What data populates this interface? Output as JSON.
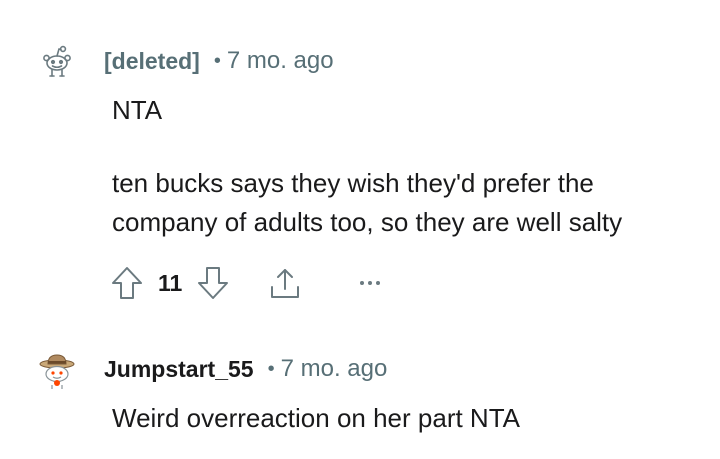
{
  "comments": [
    {
      "author": "[deleted]",
      "separator": "•",
      "time": "7 mo. ago",
      "paragraphs": [
        "NTA",
        "ten bucks says they wish they'd prefer the company of adults too, so they are well salty"
      ],
      "score": "11",
      "avatar_icon": "snoo-outline-icon",
      "actions": {
        "upvote_icon": "upvote-arrow-icon",
        "downvote_icon": "downvote-arrow-icon",
        "share_icon": "share-icon",
        "more_icon": "more-options-icon"
      }
    },
    {
      "author": "Jumpstart_55",
      "separator": "•",
      "time": "7 mo. ago",
      "paragraphs": [
        "Weird overreaction on her part NTA"
      ],
      "avatar_icon": "snoo-cowboy-hat-icon"
    }
  ],
  "colors": {
    "meta_gray": "#576f76",
    "text": "#1a1a1b",
    "icon_gray": "#6b7a80",
    "avatar_red": "#ff4500",
    "hat_brown": "#b08a60"
  }
}
